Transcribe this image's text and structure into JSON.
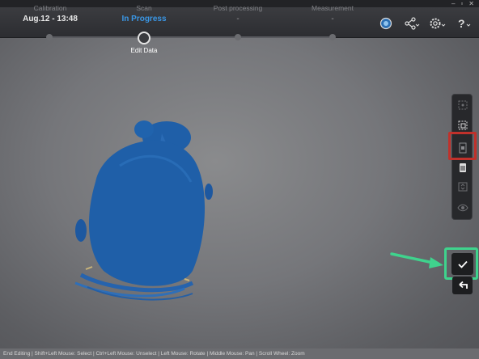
{
  "steps": [
    {
      "label": "Calibration",
      "value": "Aug.12 - 13:48"
    },
    {
      "label": "Scan",
      "value": "In Progress"
    },
    {
      "label": "Post processing",
      "value": "-"
    },
    {
      "label": "Measurement",
      "value": "-"
    }
  ],
  "current_substep": "Edit Data",
  "status_bar": "End Editing | Shift+Left Mouse: Select | Ctrl+Left Mouse: Unselect | Left Mouse: Rotate | Middle Mouse: Pan | Scroll Wheel: Zoom",
  "colors": {
    "accent": "#3a97e6",
    "highlight_red": "#c0312b",
    "highlight_green": "#3fd38d",
    "model": "#1f5fa8"
  },
  "icons": {
    "top": [
      "globe-icon",
      "share-icon",
      "settings-icon",
      "help-icon"
    ],
    "tools": [
      "rect-select-icon",
      "lasso-select-icon",
      "select-through-icon",
      "delete-icon",
      "invert-select-icon",
      "visibility-icon"
    ],
    "confirm": "check-icon",
    "undo": "undo-icon"
  }
}
